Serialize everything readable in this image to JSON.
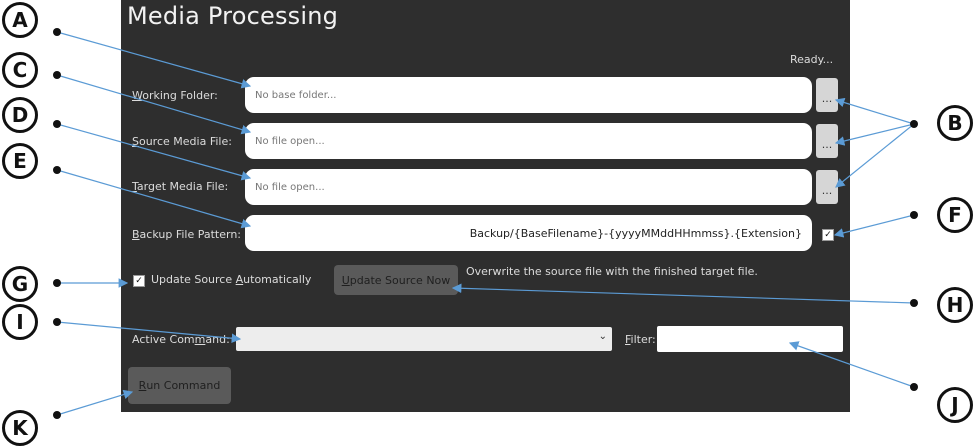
{
  "window": {
    "title": "Media Processing",
    "status": "Ready..."
  },
  "fields": {
    "working_folder": {
      "label_pre": "",
      "label_key": "W",
      "label_post": "orking Folder:",
      "placeholder": "No base folder...",
      "browse_label": "..."
    },
    "source_media": {
      "label_pre": "",
      "label_key": "S",
      "label_post": "ource Media File:",
      "placeholder": "No file open...",
      "browse_label": "..."
    },
    "target_media": {
      "label_pre": "",
      "label_key": "T",
      "label_post": "arget Media File:",
      "placeholder": "No file open...",
      "browse_label": "..."
    },
    "backup_pattern": {
      "label_pre": "",
      "label_key": "B",
      "label_post": "ackup File Pattern:",
      "value": "Backup/{BaseFilename}-{yyyyMMddHHmmss}.{Extension}",
      "checked_mark": "✓"
    }
  },
  "update_source": {
    "checkbox_mark": "✓",
    "auto_label_pre": "Update Source ",
    "auto_label_key": "A",
    "auto_label_post": "utomatically",
    "now_button_key": "U",
    "now_button_post": "pdate Source Now",
    "hint": "Overwrite the source file with the finished target file."
  },
  "command": {
    "label_pre": "Active Com",
    "label_key": "m",
    "label_post": "and:",
    "selected": "",
    "chevron": "⌄",
    "filter_key": "F",
    "filter_post": "ilter:",
    "filter_value": ""
  },
  "run": {
    "key": "R",
    "post": "un Command"
  },
  "callouts": [
    "A",
    "B",
    "C",
    "D",
    "E",
    "F",
    "G",
    "H",
    "I",
    "J",
    "K"
  ],
  "colors": {
    "panel": "#2e2e2e",
    "arrow": "#5b9bd5"
  }
}
